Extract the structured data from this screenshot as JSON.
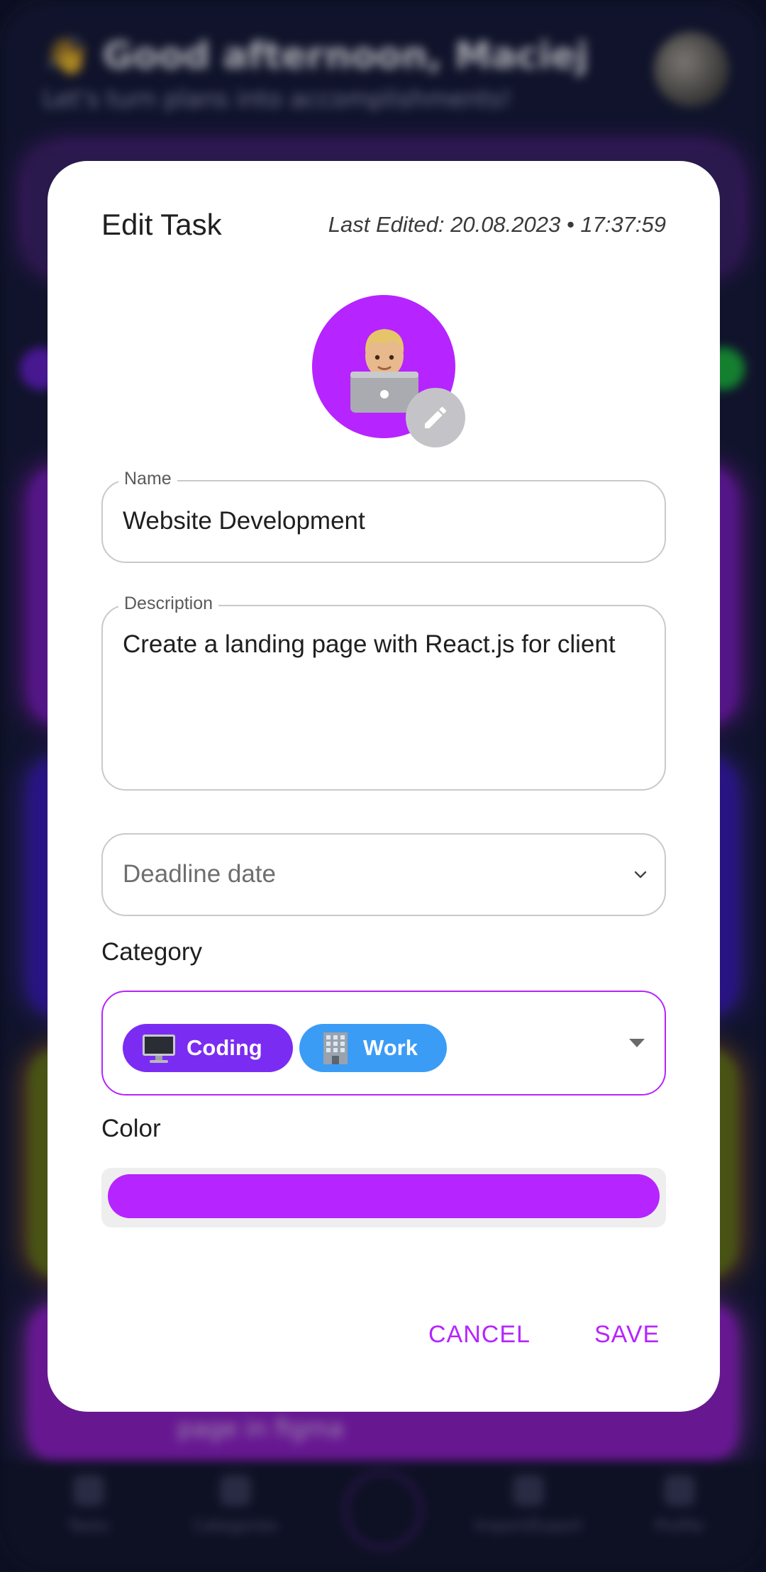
{
  "background": {
    "greeting": "Good afternoon, Maciej",
    "greeting_emoji": "👋",
    "subtitle": "Let's turn plans into accomplishments!",
    "card_text": "page in figma",
    "nav": [
      {
        "label": "Tasks",
        "icon": "tasks-icon"
      },
      {
        "label": "Categories",
        "icon": "categories-icon"
      },
      {
        "label": "Import/Export",
        "icon": "import-export-icon"
      },
      {
        "label": "Profile",
        "icon": "profile-icon"
      }
    ]
  },
  "dialog": {
    "title": "Edit Task",
    "last_edited": "Last Edited: 20.08.2023 • 17:37:59",
    "avatar_icon": "technologist-emoji",
    "avatar_color": "#b624ff",
    "edit_icon": "pencil-icon"
  },
  "form": {
    "name": {
      "label": "Name",
      "value": "Website Development"
    },
    "description": {
      "label": "Description",
      "value": "Create a landing page with React.js for client"
    },
    "deadline": {
      "placeholder": "Deadline date"
    },
    "category": {
      "label": "Category",
      "chips": [
        {
          "label": "Coding",
          "icon": "computer-emoji",
          "color": "#7b2cf2"
        },
        {
          "label": "Work",
          "icon": "office-building-emoji",
          "color": "#3b9cf5"
        }
      ]
    },
    "color": {
      "label": "Color",
      "value": "#b624ff"
    }
  },
  "actions": {
    "cancel": "CANCEL",
    "save": "SAVE"
  }
}
